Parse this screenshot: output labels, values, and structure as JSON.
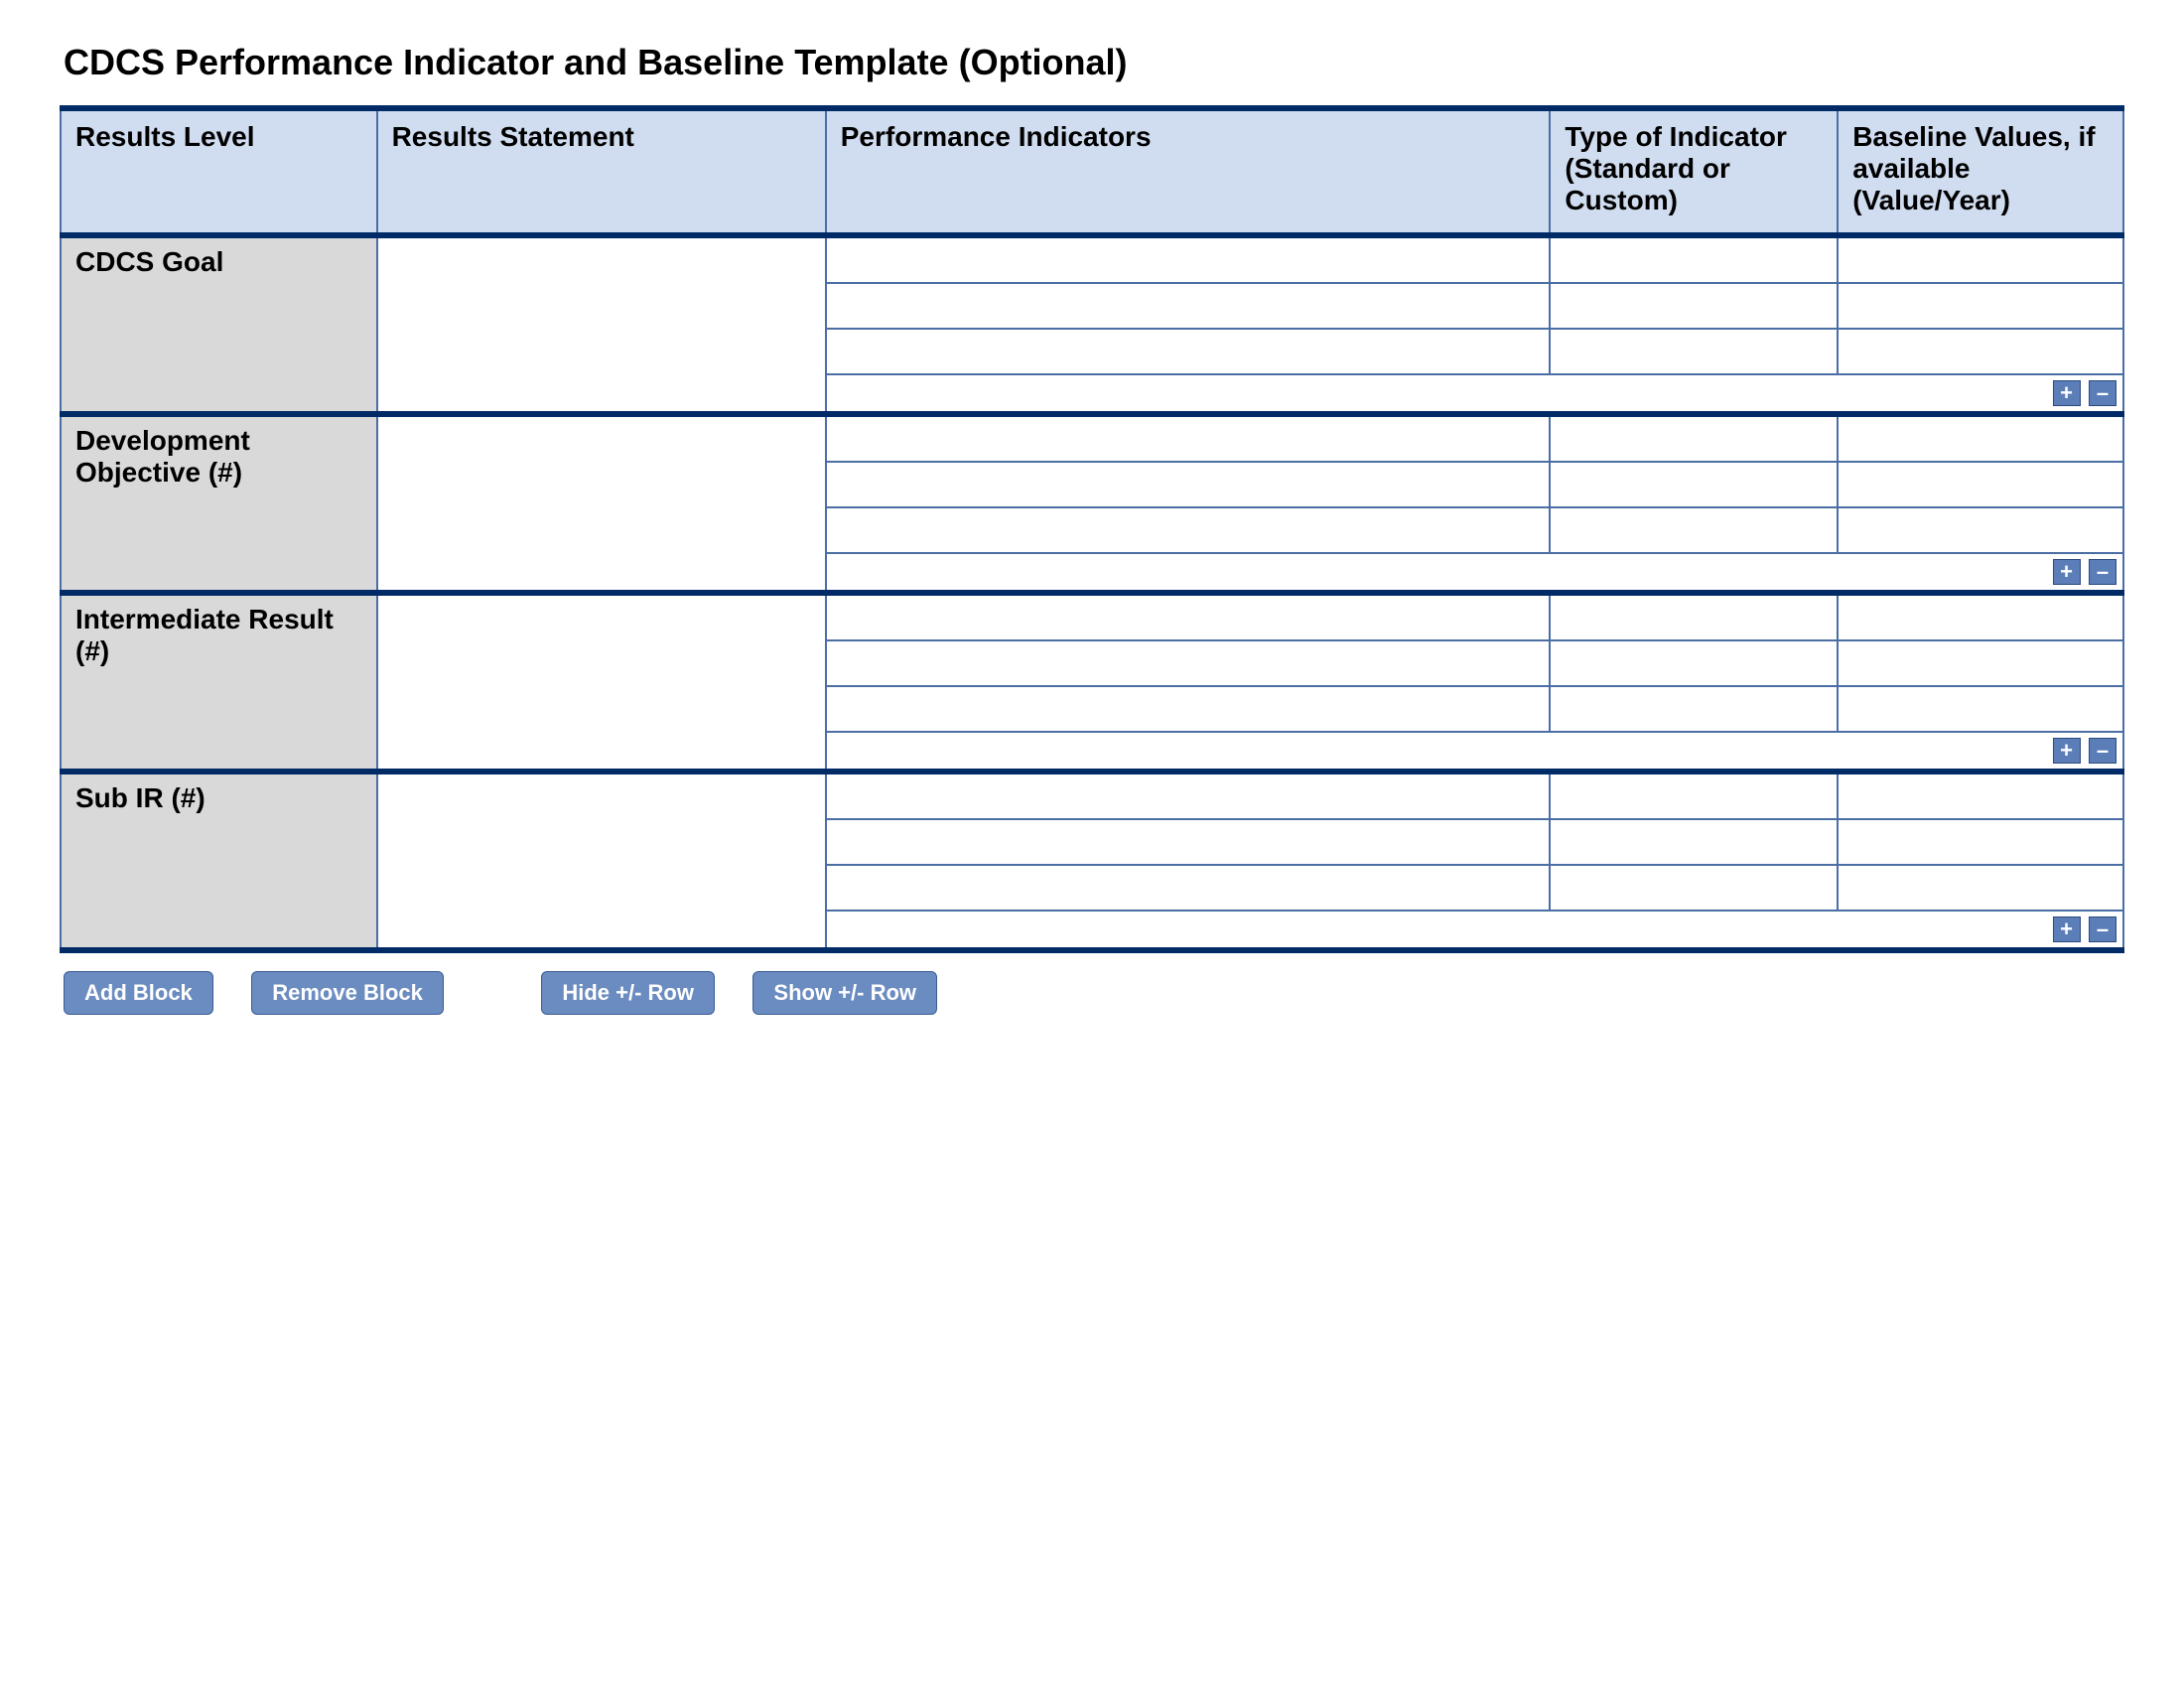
{
  "title": "CDCS Performance Indicator and Baseline Template (Optional)",
  "headers": {
    "level": "Results Level",
    "statement": "Results Statement",
    "indicators": "Performance Indicators",
    "type": "Type of Indicator (Standard or Custom)",
    "baseline": "Baseline Values, if available (Value/Year)"
  },
  "row_labels": {
    "goal": "CDCS Goal",
    "dev_obj": "Development Objective (#)",
    "ir": "Intermediate Result (#)",
    "sub_ir": "Sub IR (#)"
  },
  "icons": {
    "plus": "+",
    "minus": "–"
  },
  "buttons": {
    "add_block": "Add Block",
    "remove_block": "Remove Block",
    "hide_row": "Hide +/- Row",
    "show_row": "Show +/- Row"
  }
}
